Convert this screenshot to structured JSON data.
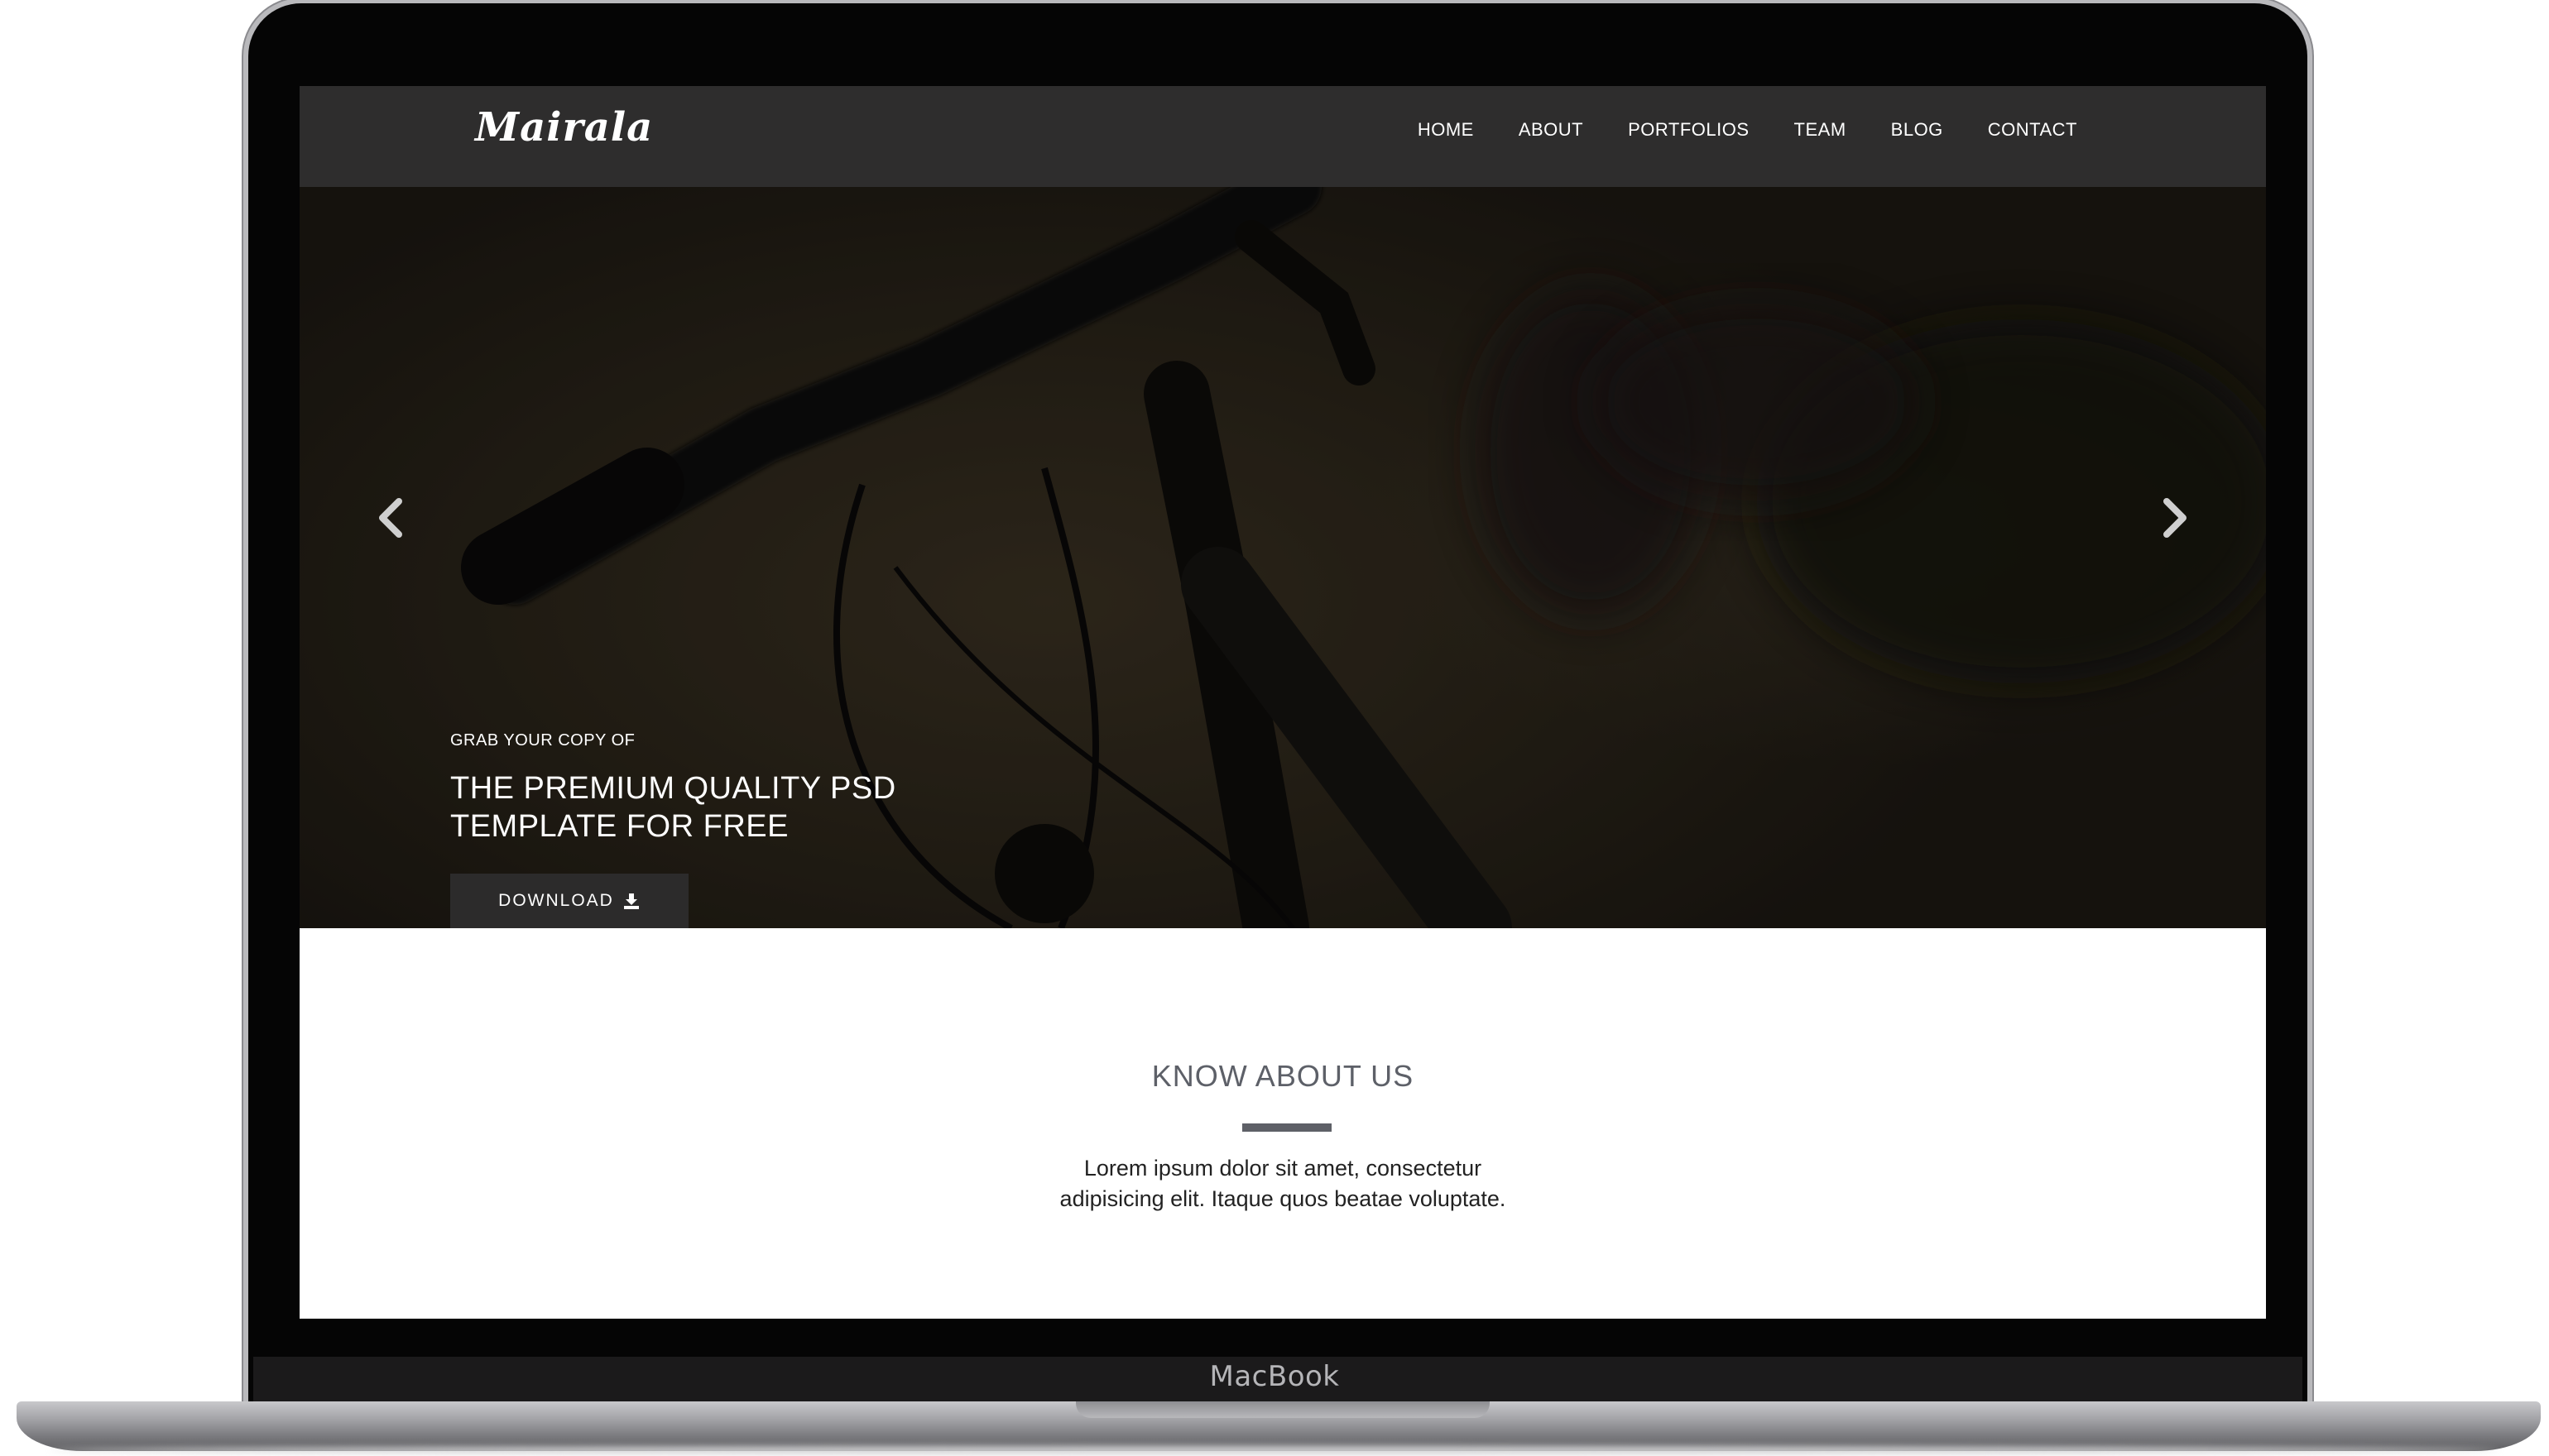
{
  "device": {
    "brand_label": "MacBook"
  },
  "navbar": {
    "logo": "Mairala",
    "items": [
      {
        "label": "HOME"
      },
      {
        "label": "ABOUT"
      },
      {
        "label": "PORTFOLIOS"
      },
      {
        "label": "TEAM"
      },
      {
        "label": "BLOG"
      },
      {
        "label": "CONTACT"
      }
    ]
  },
  "hero": {
    "kicker": "GRAB YOUR COPY OF",
    "title_line1": "THE PREMIUM QUALITY PSD",
    "title_line2": "TEMPLATE FOR FREE",
    "download_label": "DOWNLOAD",
    "download_icon": "download-icon",
    "prev_icon": "chevron-left-icon",
    "next_icon": "chevron-right-icon",
    "slides": 3,
    "active_slide": 1
  },
  "about": {
    "title": "KNOW ABOUT US",
    "text_line1": "Lorem ipsum dolor sit amet, consectetur",
    "text_line2": "adipisicing elit. Itaque quos beatae voluptate."
  },
  "colors": {
    "navbar_bg": "#2e2d2d",
    "button_bg": "#2c2b2b",
    "heading_gray": "#5d6068"
  }
}
